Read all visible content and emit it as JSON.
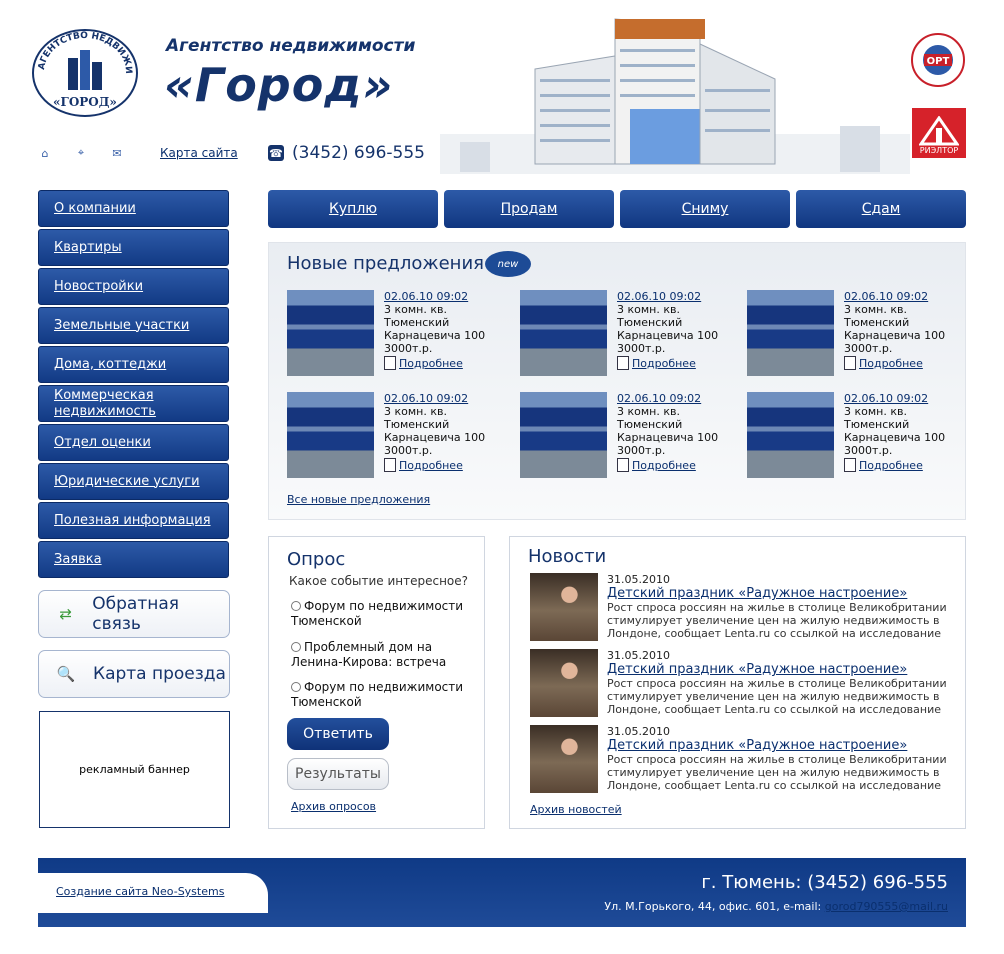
{
  "header": {
    "logo_text_top": "АГЕНТСТВО НЕДВИЖИМОСТИ",
    "logo_text_bottom": "«ГОРОД»",
    "agency_line": "Агентство недвижимости",
    "brand": "«Город»",
    "phone": "(3452) 696-555",
    "sitemap_label": "Карта сайта",
    "org_badge": "ОРТ",
    "realtor_badge": "РИЭЛТОР"
  },
  "tools": {
    "home_icon": "home-icon",
    "target_icon": "crosshair-icon",
    "mail_icon": "mail-icon"
  },
  "sidebar": {
    "items": [
      {
        "label": "О компании"
      },
      {
        "label": "Квартиры"
      },
      {
        "label": "Новостройки"
      },
      {
        "label": "Земельные участки"
      },
      {
        "label": "Дома, коттеджи"
      },
      {
        "label": "Коммерческая недвижимость"
      },
      {
        "label": "Отдел оценки"
      },
      {
        "label": "Юридические услуги"
      },
      {
        "label": "Полезная информация"
      },
      {
        "label": "Заявка"
      }
    ],
    "feedback_label": "Обратная связь",
    "map_label": "Карта проезда",
    "banner_text": "рекламный баннер"
  },
  "topnav": [
    {
      "label": "Куплю"
    },
    {
      "label": "Продам"
    },
    {
      "label": "Сниму"
    },
    {
      "label": "Сдам"
    }
  ],
  "offers": {
    "title": "Новые предложения",
    "badge": "new",
    "items": [
      {
        "date": "02.06.10 09:02",
        "rooms": "3 комн. кв.",
        "street": "Тюменский",
        "address": "Карнацевича 100",
        "price": "3000т.р.",
        "more": "Подробнее"
      },
      {
        "date": "02.06.10 09:02",
        "rooms": "3 комн. кв.",
        "street": "Тюменский",
        "address": "Карнацевича 100",
        "price": "3000т.р.",
        "more": "Подробнее"
      },
      {
        "date": "02.06.10 09:02",
        "rooms": "3 комн. кв.",
        "street": "Тюменский",
        "address": "Карнацевича 100",
        "price": "3000т.р.",
        "more": "Подробнее"
      },
      {
        "date": "02.06.10 09:02",
        "rooms": "3 комн. кв.",
        "street": "Тюменский",
        "address": "Карнацевича 100",
        "price": "3000т.р.",
        "more": "Подробнее"
      },
      {
        "date": "02.06.10 09:02",
        "rooms": "3 комн. кв.",
        "street": "Тюменский",
        "address": "Карнацевича 100",
        "price": "3000т.р.",
        "more": "Подробнее"
      },
      {
        "date": "02.06.10 09:02",
        "rooms": "3 комн. кв.",
        "street": "Тюменский",
        "address": "Карнацевича 100",
        "price": "3000т.р.",
        "more": "Подробнее"
      }
    ],
    "all_link": "Все новые предложения"
  },
  "poll": {
    "title": "Опрос",
    "question": "Какое событие интересное?",
    "options": [
      {
        "label": "Форум по недвижимости Тюменской"
      },
      {
        "label": "Проблемный дом на Ленина-Кирова: встреча"
      },
      {
        "label": "Форум по недвижимости Тюменской"
      }
    ],
    "answer_label": "Ответить",
    "results_label": "Результаты",
    "archive_label": "Архив опросов"
  },
  "news": {
    "title": "Новости",
    "items": [
      {
        "date": "31.05.2010",
        "title": "Детский праздник «Радужное настроение»",
        "text": "Рост спроса россиян на жилье в столице Великобритании стимулирует увеличение цен на жилую недвижимость в Лондоне, сообщает Lenta.ru со ссылкой на исследование"
      },
      {
        "date": "31.05.2010",
        "title": "Детский праздник «Радужное настроение»",
        "text": "Рост спроса россиян на жилье в столице Великобритании стимулирует увеличение цен на жилую недвижимость в Лондоне, сообщает Lenta.ru со ссылкой на исследование"
      },
      {
        "date": "31.05.2010",
        "title": "Детский праздник «Радужное настроение»",
        "text": "Рост спроса россиян на жилье в столице Великобритании стимулирует увеличение цен на жилую недвижимость в Лондоне, сообщает Lenta.ru со ссылкой на исследование"
      }
    ],
    "archive_label": "Архив новостей"
  },
  "footer": {
    "neo_link": "Создание сайта Neo-Systems",
    "city_phone": "г. Тюмень: (3452) 696-555",
    "address": "Ул. М.Горького, 44, офис. 601, e-mail: ",
    "email": "gorod790555@mail.ru"
  },
  "colors": {
    "brand": "#15336b",
    "button": "#1d4b96",
    "accent_red": "#d6222a"
  }
}
